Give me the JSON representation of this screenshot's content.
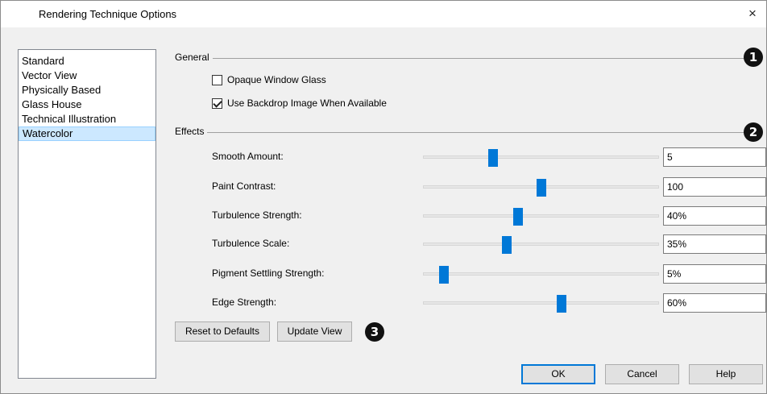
{
  "window": {
    "title": "Rendering Technique Options",
    "close_symbol": "×"
  },
  "techniques": [
    {
      "label": "Standard",
      "selected": false
    },
    {
      "label": "Vector View",
      "selected": false
    },
    {
      "label": "Physically Based",
      "selected": false
    },
    {
      "label": "Glass House",
      "selected": false
    },
    {
      "label": "Technical Illustration",
      "selected": false
    },
    {
      "label": "Watercolor",
      "selected": true
    }
  ],
  "general": {
    "label": "General",
    "callout": "1",
    "opaque_window_glass": {
      "label": "Opaque Window Glass",
      "checked": false
    },
    "use_backdrop_image": {
      "label": "Use Backdrop Image When Available",
      "checked": true
    }
  },
  "effects": {
    "label": "Effects",
    "callout": "2",
    "sliders": [
      {
        "label": "Smooth Amount:",
        "value": "5",
        "position": 0.29
      },
      {
        "label": "Paint Contrast:",
        "value": "100",
        "position": 0.5
      },
      {
        "label": "Turbulence Strength:",
        "value": "40%",
        "position": 0.4
      },
      {
        "label": "Turbulence Scale:",
        "value": "35%",
        "position": 0.35
      },
      {
        "label": "Pigment Settling Strength:",
        "value": "5%",
        "position": 0.07
      },
      {
        "label": "Edge Strength:",
        "value": "60%",
        "position": 0.59
      }
    ]
  },
  "actions": {
    "reset_label": "Reset to Defaults",
    "update_label": "Update View",
    "callout": "3"
  },
  "footer": {
    "ok_label": "OK",
    "cancel_label": "Cancel",
    "help_label": "Help"
  },
  "colors": {
    "accent": "#0078d7",
    "selection": "#cce8ff"
  }
}
